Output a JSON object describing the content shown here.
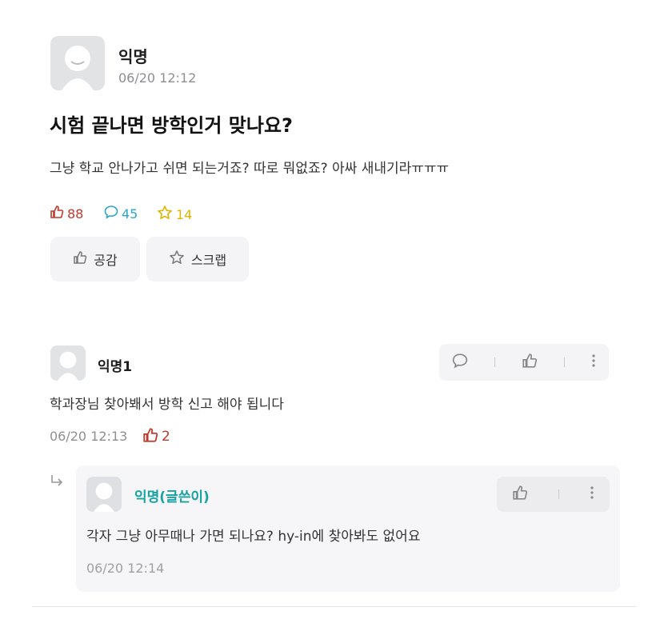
{
  "post": {
    "author": "익명",
    "timestamp": "06/20 12:12",
    "title": "시험 끝나면 방학인거 맞나요?",
    "body": "그냥 학교 안나가고 쉬면 되는거죠? 따로 뭐없죠? 아싸 새내기라ㅠㅠㅠ",
    "likes": "88",
    "comments": "45",
    "scraps": "14",
    "like_button_label": "공감",
    "scrap_button_label": "스크랩"
  },
  "comments": [
    {
      "author": "익명1",
      "text": "학과장님 찾아봬서 방학 신고 해야 됩니다",
      "timestamp": "06/20 12:13",
      "likes": "2"
    }
  ],
  "reply": {
    "author": "익명(글쓴이)",
    "text": "각자 그냥 아무때나 가면 되나요? hy-in에 찾아봐도 없어요",
    "timestamp": "06/20 12:14"
  },
  "colors": {
    "like_red": "#c0392b",
    "comment_teal": "#2aa7c9",
    "scrap_yellow": "#e0b400",
    "author_teal": "#15a2a2"
  }
}
